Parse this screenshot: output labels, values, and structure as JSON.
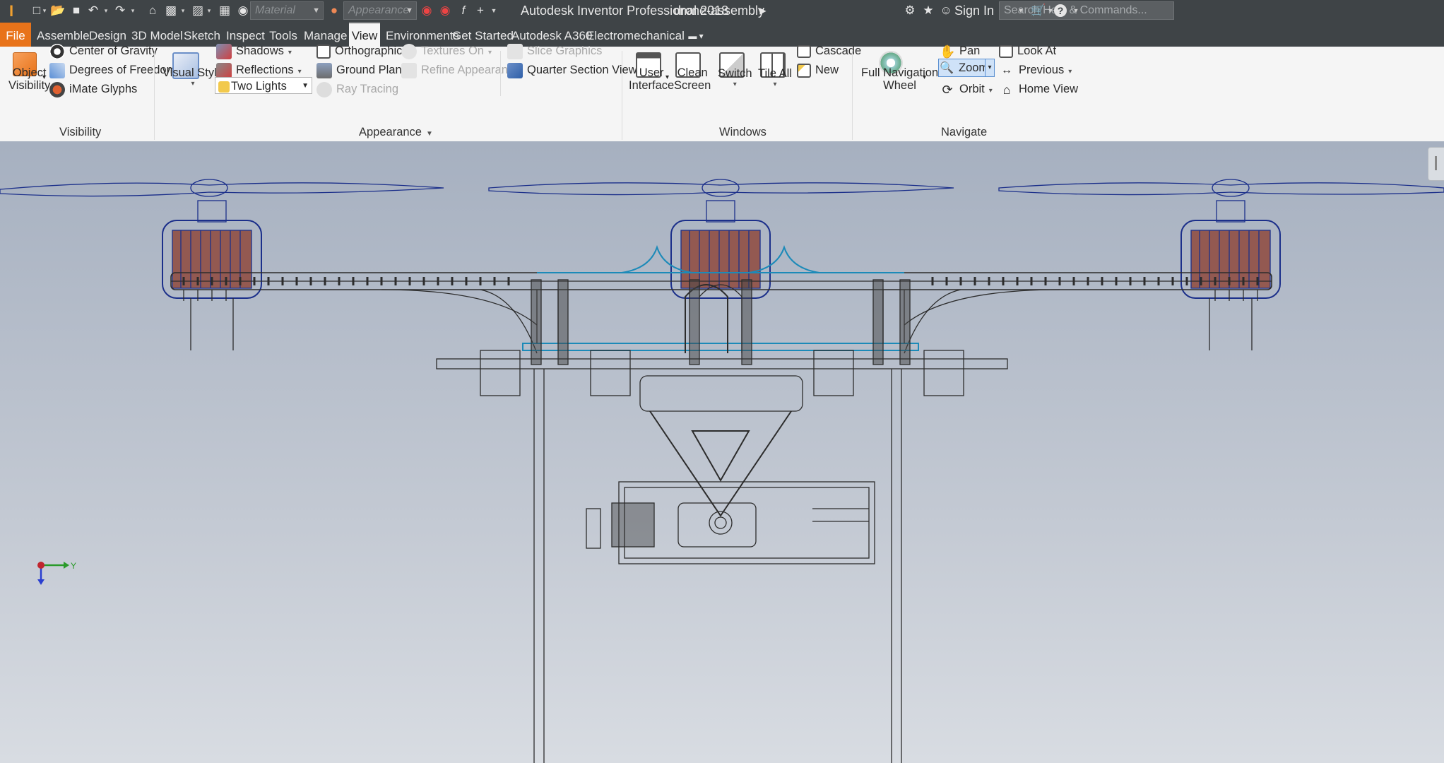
{
  "app": {
    "logo_text": "I",
    "title": "Autodesk Inventor Professional 2018",
    "document": "drone-assembly"
  },
  "qat": {
    "material_placeholder": "Material",
    "appearance_placeholder": "Appearance",
    "icons": [
      "new-icon",
      "open-icon",
      "save-icon",
      "undo-icon",
      "redo-icon",
      "home-icon",
      "update-icon",
      "select-icon",
      "color-icon",
      "appearance-icon",
      "clear-appearance-icon",
      "fx-icon",
      "plus-icon",
      "customize-icon"
    ]
  },
  "search": {
    "placeholder": "Search Help & Commands..."
  },
  "header_right": {
    "sign_in": "Sign In"
  },
  "tabs": [
    {
      "label": "File"
    },
    {
      "label": "Assemble"
    },
    {
      "label": "Design"
    },
    {
      "label": "3D Model"
    },
    {
      "label": "Sketch"
    },
    {
      "label": "Inspect"
    },
    {
      "label": "Tools"
    },
    {
      "label": "Manage"
    },
    {
      "label": "View"
    },
    {
      "label": "Environments"
    },
    {
      "label": "Get Started"
    },
    {
      "label": "Autodesk A360"
    },
    {
      "label": "Electromechanical"
    }
  ],
  "active_tab": "View",
  "ribbon": {
    "visibility": {
      "object_visibility_line1": "Object",
      "object_visibility_line2": "Visibility",
      "center_of_gravity": "Center of Gravity",
      "degrees_of_freedom": "Degrees of Freedom",
      "imate_glyphs": "iMate Glyphs",
      "panel": "Visibility"
    },
    "appearance": {
      "visual_style": "Visual Style",
      "shadows": "Shadows",
      "reflections": "Reflections",
      "lighting_value": "Two Lights",
      "orthographic": "Orthographic",
      "ground_plane": "Ground Plane",
      "ray_tracing": "Ray Tracing",
      "textures_on": "Textures On",
      "refine_appearance": "Refine Appearance",
      "slice_graphics": "Slice Graphics",
      "quarter_section_view": "Quarter Section View",
      "panel": "Appearance"
    },
    "windows": {
      "user_interface_line1": "User",
      "user_interface_line2": "Interface",
      "clean_screen_line1": "Clean",
      "clean_screen_line2": "Screen",
      "switch": "Switch",
      "tile_all": "Tile All",
      "cascade": "Cascade",
      "new": "New",
      "panel": "Windows"
    },
    "navigate": {
      "full_nav_wheel_line1": "Full Navigation",
      "full_nav_wheel_line2": "Wheel",
      "pan": "Pan",
      "zoom": "Zoom",
      "orbit": "Orbit",
      "look_at": "Look At",
      "previous": "Previous",
      "home_view": "Home View",
      "panel": "Navigate"
    }
  },
  "triad": {
    "y_label": "Y"
  },
  "colors": {
    "accent_orange": "#e8731a",
    "titlebar": "#3f4447",
    "wire": "#2c2c2c",
    "motor_wire": "#1b2f8a",
    "motor_core": "#8a3a2a",
    "highlight": "#1c8ab8"
  }
}
